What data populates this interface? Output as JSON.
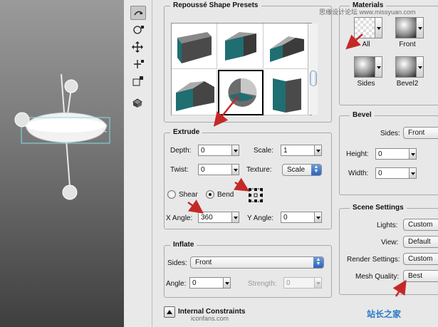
{
  "watermark_top": "思缘设计论坛 www.missyuan.com",
  "presets": {
    "title": "Repoussé Shape Presets",
    "count": 6,
    "selected_index": 4
  },
  "materials": {
    "title": "Materials",
    "items": [
      {
        "label": "All"
      },
      {
        "label": "Front"
      },
      {
        "label": "Sides"
      },
      {
        "label": "Bevel2"
      }
    ]
  },
  "extrude": {
    "title": "Extrude",
    "depth_label": "Depth:",
    "depth_value": "0",
    "scale_label": "Scale:",
    "scale_value": "1",
    "twist_label": "Twist:",
    "twist_value": "0",
    "texture_label": "Texture:",
    "texture_value": "Scale",
    "shear_label": "Shear",
    "bend_label": "Bend",
    "selected_mode": "Bend",
    "xangle_label": "X Angle:",
    "xangle_value": "360",
    "yangle_label": "Y Angle:",
    "yangle_value": "0"
  },
  "bevel": {
    "title": "Bevel",
    "sides_label": "Sides:",
    "sides_value": "Front",
    "height_label": "Height:",
    "height_value": "0",
    "width_label": "Width:",
    "width_value": "0"
  },
  "inflate": {
    "title": "Inflate",
    "sides_label": "Sides:",
    "sides_value": "Front",
    "angle_label": "Angle:",
    "angle_value": "0",
    "strength_label": "Strength:",
    "strength_value": "0"
  },
  "scene": {
    "title": "Scene Settings",
    "lights_label": "Lights:",
    "lights_value": "Custom",
    "view_label": "View:",
    "view_value": "Default",
    "render_label": "Render Settings:",
    "render_value": "Custom",
    "mesh_label": "Mesh Quality:",
    "mesh_value": "Best"
  },
  "internal": {
    "title": "Internal Constraints",
    "watermark": "iconfans.com"
  },
  "logo_text": "站长之家",
  "colors": {
    "accent_teal": "#1f6e72",
    "arrow_red": "#c62828",
    "selection_cyan": "#4fd1e0"
  }
}
